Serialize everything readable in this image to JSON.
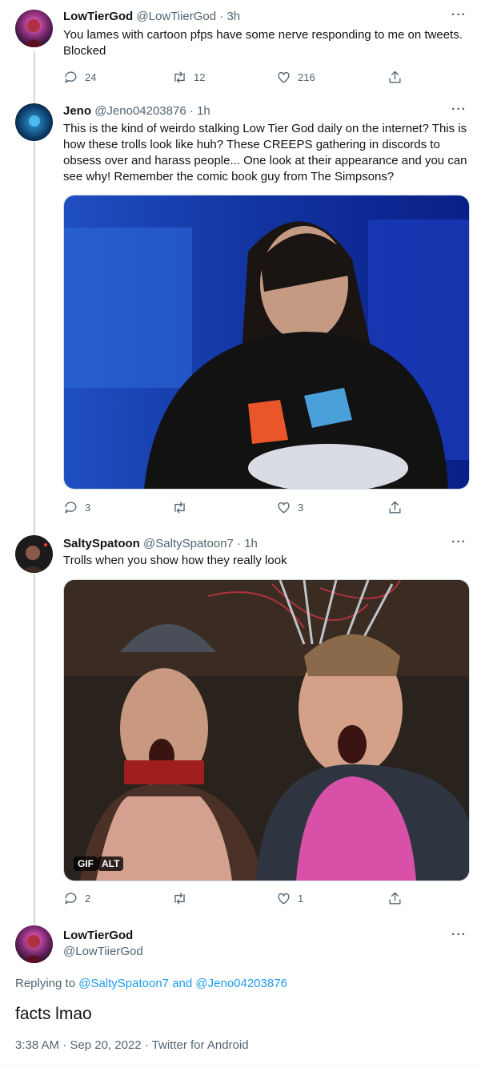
{
  "tweets": [
    {
      "name": "LowTierGod",
      "handle": "@LowTiierGod",
      "time": "3h",
      "text": "You lames with cartoon pfps have some nerve responding to me on tweets. Blocked",
      "replies": "24",
      "retweets": "12",
      "likes": "216"
    },
    {
      "name": "Jeno",
      "handle": "@Jeno04203876",
      "time": "1h",
      "text": "This is the kind of weirdo stalking Low Tier God daily on the internet? This is how these trolls look like huh? These CREEPS gathering in discords to obsess over and harass people... One look at their appearance and you can see why! Remember the comic book guy from The Simpsons?",
      "replies": "3",
      "retweets": "",
      "likes": "3"
    },
    {
      "name": "SaltySpatoon",
      "handle": "@SaltySpatoon7",
      "time": "1h",
      "text": "Trolls when you show how they really look",
      "replies": "2",
      "retweets": "",
      "likes": "1",
      "media_badges": [
        "GIF",
        "ALT"
      ]
    }
  ],
  "main_tweet": {
    "name": "LowTierGod",
    "handle": "@LowTiierGod",
    "replying_prefix": "Replying to",
    "replying_to_1": "@SaltySpatoon7",
    "replying_and": "and",
    "replying_to_2": "@Jeno04203876",
    "text": "facts lmao",
    "timestamp": "3:38 AM · Sep 20, 2022 · Twitter for Android"
  },
  "ui": {
    "more_glyph": "···",
    "separator": "·"
  },
  "colors": {
    "accent": "#1d9bf0",
    "secondary_text": "#536471",
    "thread_line": "#cfd9de"
  }
}
